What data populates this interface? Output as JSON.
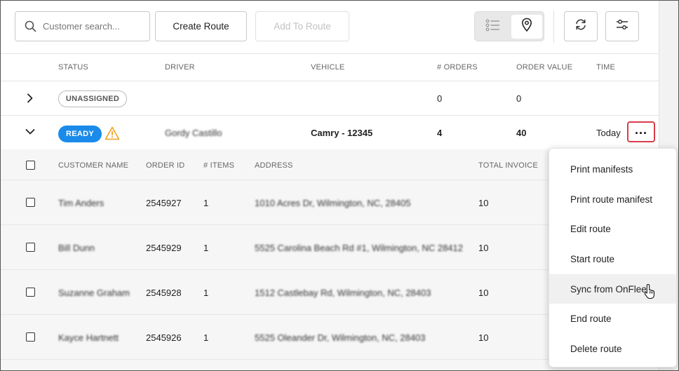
{
  "toolbar": {
    "search_placeholder": "Customer search...",
    "create_route_label": "Create Route",
    "add_to_route_label": "Add To Route"
  },
  "table": {
    "headers": {
      "status": "STATUS",
      "driver": "DRIVER",
      "vehicle": "VEHICLE",
      "orders": "# ORDERS",
      "order_value": "ORDER VALUE",
      "time": "TIME"
    },
    "routes": [
      {
        "status": "UNASSIGNED",
        "driver": "",
        "vehicle": "",
        "orders": "0",
        "order_value": "0",
        "time": ""
      },
      {
        "status": "READY",
        "driver": "Gordy Castillo",
        "vehicle": "Camry - 12345",
        "orders": "4",
        "order_value": "40",
        "time": "Today 1"
      }
    ]
  },
  "orders": {
    "headers": {
      "customer_name": "CUSTOMER NAME",
      "order_id": "ORDER ID",
      "items": "# ITEMS",
      "address": "ADDRESS",
      "total_invoice": "TOTAL INVOICE"
    },
    "rows": [
      {
        "customer_name": "Tim Anders",
        "order_id": "2545927",
        "items": "1",
        "address": "1010 Acres Dr, Wilmington, NC, 28405",
        "total_invoice": "10"
      },
      {
        "customer_name": "Bill Dunn",
        "order_id": "2545929",
        "items": "1",
        "address": "5525 Carolina Beach Rd #1, Wilmington, NC 28412",
        "total_invoice": "10"
      },
      {
        "customer_name": "Suzanne Graham",
        "order_id": "2545928",
        "items": "1",
        "address": "1512 Castlebay Rd, Wilmington, NC, 28403",
        "total_invoice": "10"
      },
      {
        "customer_name": "Kayce Hartnett",
        "order_id": "2545926",
        "items": "1",
        "address": "5525 Oleander Dr, Wilmington, NC, 28403",
        "total_invoice": "10"
      }
    ]
  },
  "menu": {
    "items": [
      "Print manifests",
      "Print route manifest",
      "Edit route",
      "Start route",
      "Sync from OnFleet",
      "End route",
      "Delete route"
    ],
    "hovered_index": 4
  },
  "colors": {
    "ready_badge": "#1a8bea",
    "warning": "#f0a020",
    "highlight_border": "#d93d4a"
  },
  "icons": [
    "search-icon",
    "list-view-icon",
    "map-pin-icon",
    "sync-icon",
    "filter-sliders-icon",
    "chevron-right-icon",
    "chevron-down-icon",
    "warning-icon",
    "more-horizontal-icon",
    "pointer-cursor-icon"
  ]
}
